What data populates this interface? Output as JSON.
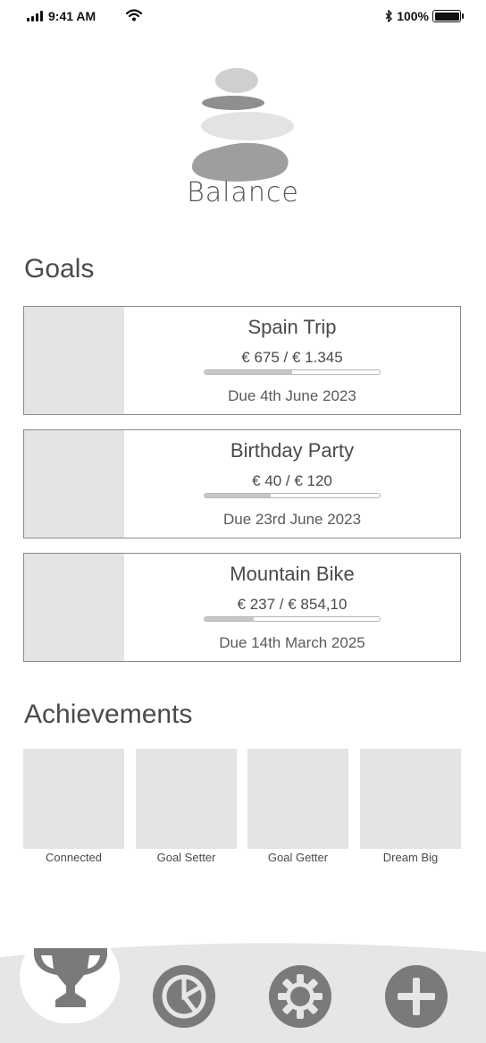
{
  "status_bar": {
    "time": "9:41 AM",
    "battery": "100%"
  },
  "app": {
    "name": "Balance"
  },
  "goals": {
    "title": "Goals",
    "items": [
      {
        "name": "Spain Trip",
        "amount": "€ 675 / € 1.345",
        "progress": 0.5,
        "due": "Due 4th June 2023"
      },
      {
        "name": "Birthday Party",
        "amount": "€ 40 / € 120",
        "progress": 0.38,
        "due": "Due 23rd June 2023"
      },
      {
        "name": "Mountain Bike",
        "amount": "€ 237 / € 854,10",
        "progress": 0.28,
        "due": "Due 14th March 2025"
      }
    ]
  },
  "achievements": {
    "title": "Achievements",
    "items": [
      {
        "label": "Connected"
      },
      {
        "label": "Goal Setter"
      },
      {
        "label": "Goal Getter"
      },
      {
        "label": "Dream Big"
      }
    ]
  },
  "nav": {
    "items": [
      {
        "icon": "trophy-icon",
        "active": true
      },
      {
        "icon": "pie-chart-icon",
        "active": false
      },
      {
        "icon": "gear-icon",
        "active": false
      },
      {
        "icon": "plus-icon",
        "active": false
      }
    ]
  },
  "colors": {
    "thumb": "#e4e4e6",
    "nav_bg": "#e6e6e8",
    "icon": "#7a7a7a"
  }
}
